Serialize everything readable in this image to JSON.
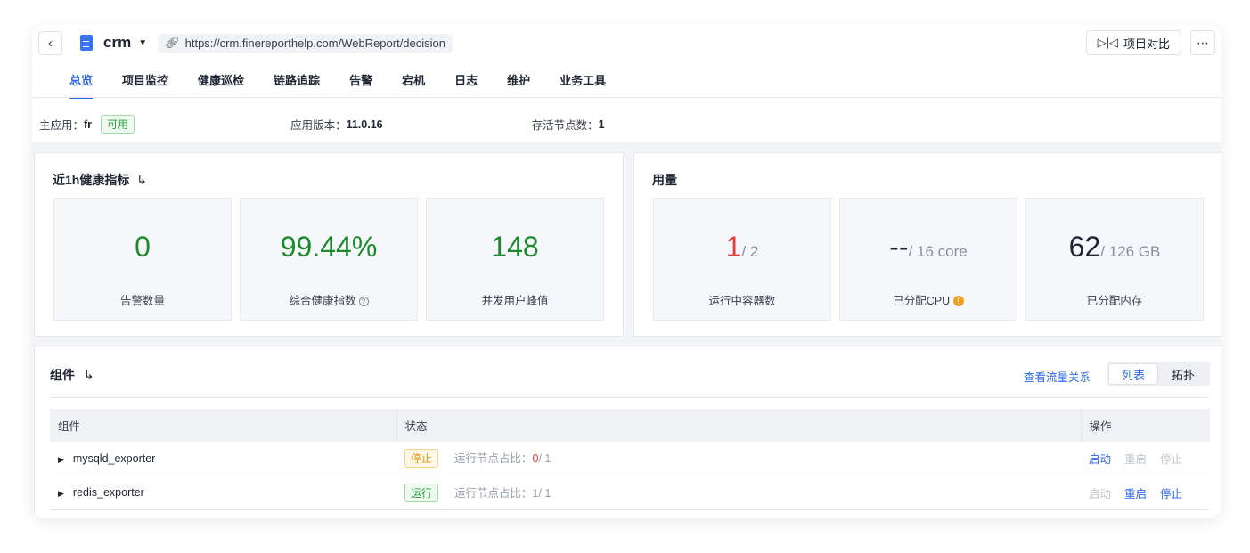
{
  "header": {
    "title": "crm",
    "url": "https://crm.finereporthelp.com/WebReport/decision",
    "compare": "项目对比"
  },
  "tabs": [
    "总览",
    "项目监控",
    "健康巡检",
    "链路追踪",
    "告警",
    "宕机",
    "日志",
    "维护",
    "业务工具"
  ],
  "info": {
    "app_label": "主应用：",
    "app": "fr",
    "app_status": "可用",
    "version_label": "应用版本：",
    "version": "11.0.16",
    "nodes_label": "存活节点数：",
    "nodes": "1"
  },
  "health": {
    "title": "近1h健康指标",
    "tiles": [
      {
        "value": "0",
        "label": "告警数量"
      },
      {
        "value": "99.44%",
        "label": "综合健康指数"
      },
      {
        "value": "148",
        "label": "并发用户峰值"
      }
    ]
  },
  "usage": {
    "title": "用量",
    "tiles": [
      {
        "value": "1",
        "total": "/ 2",
        "label": "运行中容器数"
      },
      {
        "value": "--",
        "total": "/ 16 core",
        "label": "已分配CPU"
      },
      {
        "value": "62",
        "total": "/ 126 GB",
        "label": "已分配内存"
      }
    ]
  },
  "components": {
    "title": "组件",
    "flow_link": "查看流量关系",
    "views": [
      "列表",
      "拓扑"
    ],
    "columns": [
      "组件",
      "状态",
      "操作"
    ],
    "rows": [
      {
        "name": "mysqld_exporter",
        "status": "停止",
        "ratio_label": "运行节点占比：",
        "running": "0",
        "total": "/ 1",
        "actions": [
          "启动",
          "重启",
          "停止"
        ]
      },
      {
        "name": "redis_exporter",
        "status": "运行",
        "ratio_label": "运行节点占比：",
        "running": "1",
        "total": "/ 1",
        "actions": [
          "启动",
          "重启",
          "停止"
        ]
      }
    ]
  }
}
